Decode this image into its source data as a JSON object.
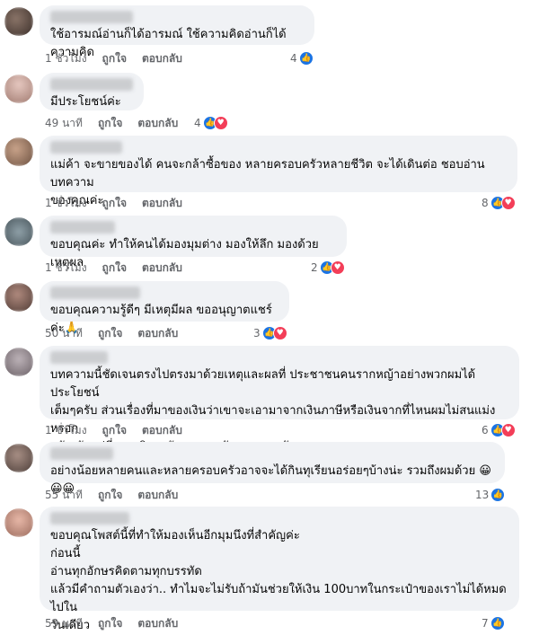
{
  "comments": [
    {
      "text": "ใช้อารมณ์อ่านก็ได้อารมณ์ ใช้ความคิดอ่านก็ได้ความคิด",
      "time": "1 ชั่วโมง",
      "count": "4",
      "reactions": [
        "like"
      ]
    },
    {
      "text": "มีประโยชน์ค่ะ",
      "time": "49 นาที",
      "count": "4",
      "reactions": [
        "like",
        "love"
      ]
    },
    {
      "text": "แม่ค้า จะขายของได้ คนจะกล้าซื้อของ หลายครอบครัวหลายชีวิต จะได้เดินต่อ ชอบอ่านบทความ\nของคุณค่ะ",
      "time": "1 ชั่วโมง",
      "count": "8",
      "reactions": [
        "like",
        "love"
      ]
    },
    {
      "text": "ขอบคุณค่ะ ทำให้คนได้มองมุมต่าง มองให้ลึก มองด้วยเหตุผล",
      "time": "1 ชั่วโมง",
      "count": "2",
      "reactions": [
        "like",
        "love"
      ]
    },
    {
      "text": "ขอบคุณความรู้ดีๆ มีเหตุมีผล ขออนุญาตแชร์ค่ะ",
      "emoji": "🙏",
      "time": "50 นาที",
      "count": "3",
      "reactions": [
        "like",
        "love"
      ]
    },
    {
      "text": "บทความนี้ชัดเจนตรงไปตรงมาด้วยเหตุและผลที่ ประชาชนคนรากหญ้าอย่างพวกผมได้ประโยชน์\nเต็มๆครับ ส่วนเรื่องที่มาของเงินว่าเขาจะเอามาจากเงินภาษีหรือเงินจากที่ไหนผมไม่สนแม่งหรอก\nครับ มันอยู่ที่การบริหารจัดการของรัฐบาลเขาครับ",
      "time": "1 ชั่วโมง",
      "count": "6",
      "reactions": [
        "like",
        "love"
      ]
    },
    {
      "text": "อย่างน้อยหลายคนและหลายครอบครัวอาจจะได้กินทุเรียนอร่อยๆบ้างน่ะ รวมถึงผมด้วย",
      "emoji": "😀😀😀",
      "time": "55 นาที",
      "count": "13",
      "reactions": [
        "like"
      ]
    },
    {
      "text": "ขอบคุณโพสต์นี้ที่ทำให้มองเห็นอีกมุมนึงที่สำคัญค่ะ\nก่อนนี้\nอ่านทุกอักษรคิดตามทุกบรรทัด\nแล้วมีคำถามตัวเองว่า.. ทำไมจะไม่รับถ้ามันช่วยให้เงิน 100บาทในกระเป๋าของเราไม่ได้หมดไปใน\nวันเดียว",
      "time": "59 นาที",
      "count": "7",
      "reactions": [
        "like"
      ]
    }
  ],
  "labels": {
    "like": "ถูกใจ",
    "reply": "ตอบกลับ"
  },
  "icons": {
    "like": "thumbs-up-icon",
    "love": "heart-icon"
  },
  "colors": {
    "bubble": "#f0f2f5",
    "meta": "#65676b",
    "like": "#1b74e4",
    "love": "#f33e58"
  }
}
